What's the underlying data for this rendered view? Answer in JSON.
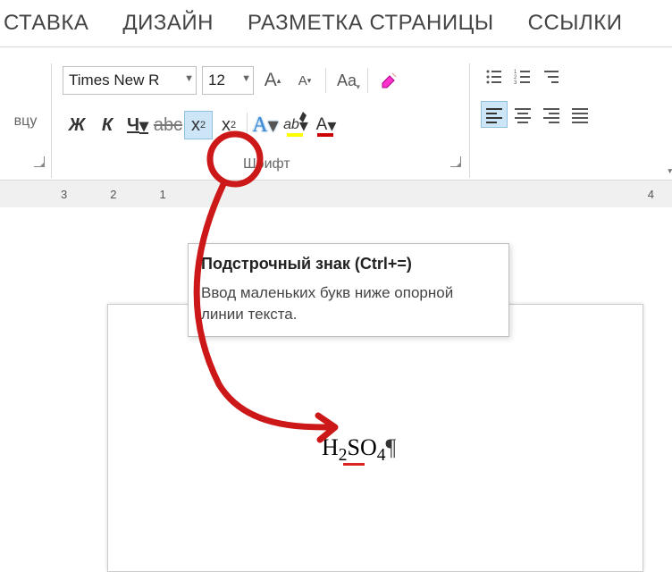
{
  "tabs": {
    "insert": "СТАВКА",
    "design": "ДИЗАЙН",
    "layout": "РАЗМЕТКА СТРАНИЦЫ",
    "links": "ССЫЛКИ"
  },
  "ribbon": {
    "left_label": "вцу",
    "font_name": "Times New R",
    "font_size": "12",
    "group_font_label": "Шрифт",
    "buttons": {
      "bold": "Ж",
      "italic": "К",
      "underline": "Ч",
      "strike": "abc",
      "subscript": "x",
      "subscript_sub": "2",
      "superscript": "x",
      "superscript_sup": "2",
      "caseA": "Aa",
      "texteffect": "A",
      "highlight": "ab",
      "fontcolor": "A",
      "grow": "A",
      "shrink": "A"
    }
  },
  "ruler": {
    "n3": "3",
    "n2": "2",
    "n1": "1",
    "n4": "4"
  },
  "tooltip": {
    "title": "Подстрочный знак (Ctrl+=)",
    "body": "Ввод маленьких букв ниже опорной линии текста."
  },
  "document": {
    "formula_h": "H",
    "formula_2a": "2",
    "formula_so": "SO",
    "formula_4": "4",
    "pilcrow": "¶"
  }
}
